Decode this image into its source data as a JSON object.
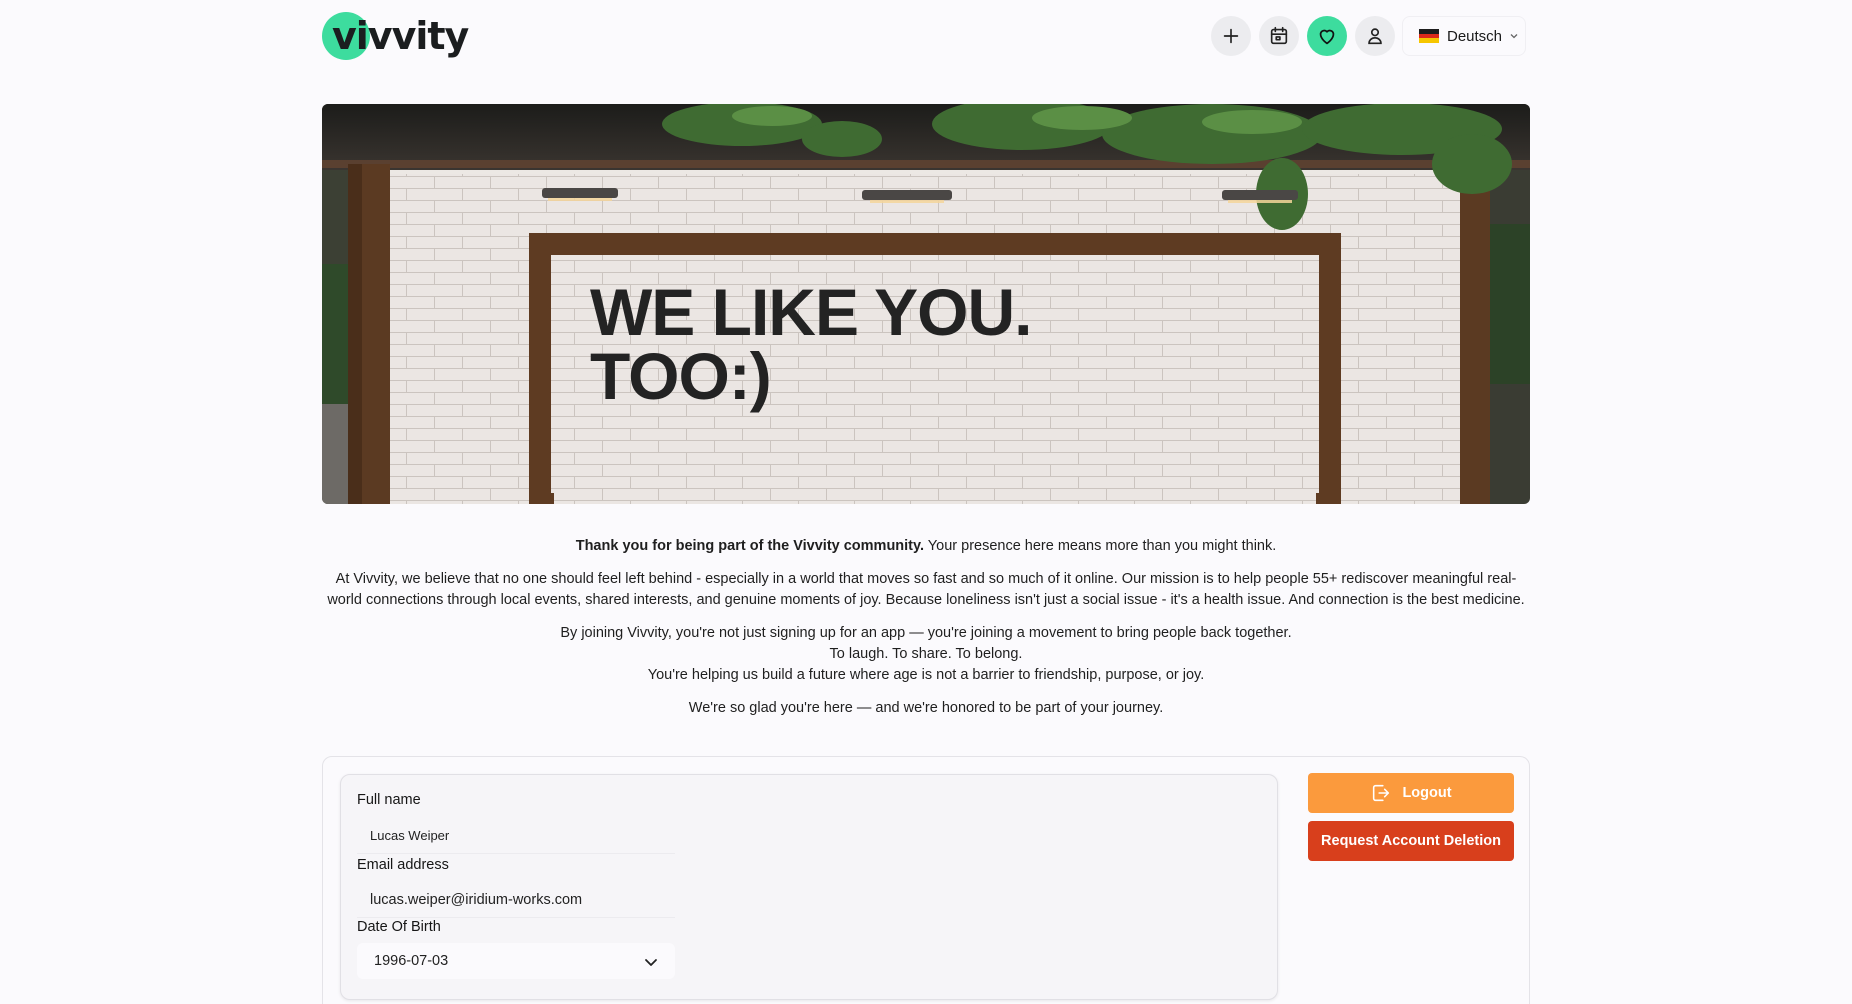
{
  "header": {
    "logo_text": "vivvity",
    "brand_color": "#3ddc9e",
    "buttons": [
      {
        "icon": "plus-icon"
      },
      {
        "icon": "calendar-icon"
      },
      {
        "icon": "heart-icon",
        "active": true
      },
      {
        "icon": "user-icon"
      }
    ],
    "language": {
      "label": "Deutsch",
      "flag": "germany-flag-icon"
    }
  },
  "hero": {
    "line1": "WE LIKE YOU.",
    "line2": "TOO:)"
  },
  "intro": {
    "lead_bold": "Thank you for being part of the Vivvity community.",
    "lead_rest": " Your presence here means more than you might think.",
    "mission": "At Vivvity, we believe that no one should feel left behind - especially in a world that moves so fast and so much of it online. Our mission is to help people 55+ rediscover meaningful real-world connections through local events, shared interests, and genuine moments of joy. Because loneliness isn't just a social issue - it's a health issue. And connection is the best medicine.",
    "joining_1": "By joining Vivvity, you're not just signing up for an app — you're joining a movement to bring people back together.",
    "joining_2": "To laugh. To share. To belong.",
    "joining_3": "You're helping us build a future where age is not a barrier to friendship, purpose, or joy.",
    "closing": "We're so glad you're here — and we're honored to be part of your journey."
  },
  "profile": {
    "full_name_label": "Full name",
    "full_name_value": "Lucas Weiper",
    "email_label": "Email address",
    "email_value": "lucas.weiper@iridium-works.com",
    "dob_label": "Date Of Birth",
    "dob_value": "1996-07-03"
  },
  "actions": {
    "logout_label": "Logout",
    "logout_color": "#fb9a3d",
    "delete_label": "Request Account Deletion",
    "delete_color": "#d83f1c"
  }
}
